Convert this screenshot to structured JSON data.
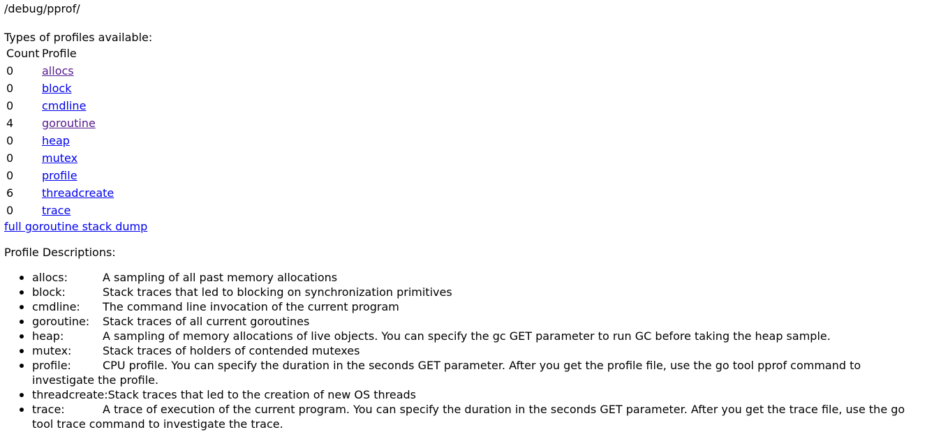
{
  "path_title": "/debug/pprof/",
  "types_label": "Types of profiles available:",
  "table": {
    "headers": {
      "count": "Count",
      "profile": "Profile"
    },
    "rows": [
      {
        "count": "0",
        "name": "allocs",
        "visited": true
      },
      {
        "count": "0",
        "name": "block",
        "visited": false
      },
      {
        "count": "0",
        "name": "cmdline",
        "visited": false
      },
      {
        "count": "4",
        "name": "goroutine",
        "visited": true
      },
      {
        "count": "0",
        "name": "heap",
        "visited": false
      },
      {
        "count": "0",
        "name": "mutex",
        "visited": false
      },
      {
        "count": "0",
        "name": "profile",
        "visited": false
      },
      {
        "count": "6",
        "name": "threadcreate",
        "visited": false
      },
      {
        "count": "0",
        "name": "trace",
        "visited": false
      }
    ]
  },
  "dump_link": "full goroutine stack dump",
  "descriptions_label": "Profile Descriptions:",
  "descriptions": [
    {
      "name": "allocs:",
      "text": "A sampling of all past memory allocations"
    },
    {
      "name": "block:",
      "text": "Stack traces that led to blocking on synchronization primitives"
    },
    {
      "name": "cmdline:",
      "text": "The command line invocation of the current program"
    },
    {
      "name": "goroutine:",
      "text": "Stack traces of all current goroutines"
    },
    {
      "name": "heap:",
      "text": "A sampling of memory allocations of live objects. You can specify the gc GET parameter to run GC before taking the heap sample."
    },
    {
      "name": "mutex:",
      "text": "Stack traces of holders of contended mutexes"
    },
    {
      "name": "profile:",
      "text": "CPU profile. You can specify the duration in the seconds GET parameter. After you get the profile file, use the go tool pprof command to investigate the profile."
    },
    {
      "name": "threadcreate:",
      "text": "Stack traces that led to the creation of new OS threads"
    },
    {
      "name": "trace:",
      "text": "A trace of execution of the current program. You can specify the duration in the seconds GET parameter. After you get the trace file, use the go tool trace command to investigate the trace."
    }
  ],
  "colors": {
    "link": "#0000ee",
    "visited_link": "#551a8b",
    "text": "#000000",
    "background": "#ffffff"
  }
}
